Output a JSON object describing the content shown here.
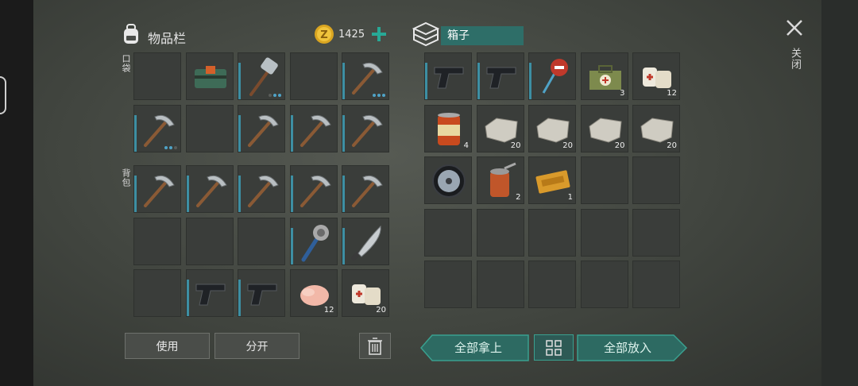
{
  "inventory": {
    "title": "物品栏",
    "coins": "1425",
    "pocket_label": "口袋",
    "backpack_label": "背包"
  },
  "box": {
    "title": "箱子"
  },
  "close_label": "关闭",
  "buttons": {
    "use": "使用",
    "split": "分开",
    "take_all": "全部拿上",
    "put_all": "全部放入"
  },
  "pocket_slots": [
    {
      "item": "empty"
    },
    {
      "item": "explosive-pack"
    },
    {
      "item": "sledgehammer",
      "dots": [
        false,
        true,
        true
      ]
    },
    {
      "item": "empty"
    },
    {
      "item": "pickaxe",
      "dots": [
        true,
        true,
        true
      ]
    },
    {
      "item": "pickaxe",
      "dots": [
        true,
        true,
        false
      ]
    },
    {
      "item": "empty"
    },
    {
      "item": "pickaxe"
    },
    {
      "item": "pickaxe"
    },
    {
      "item": "pickaxe"
    }
  ],
  "backpack_slots": [
    {
      "item": "pickaxe"
    },
    {
      "item": "pickaxe"
    },
    {
      "item": "pickaxe"
    },
    {
      "item": "pickaxe"
    },
    {
      "item": "pickaxe"
    },
    {
      "item": "empty"
    },
    {
      "item": "empty"
    },
    {
      "item": "empty"
    },
    {
      "item": "spiked-club"
    },
    {
      "item": "machete"
    },
    {
      "item": "empty"
    },
    {
      "item": "pistol"
    },
    {
      "item": "pistol"
    },
    {
      "item": "raw-chicken",
      "qty": "12"
    },
    {
      "item": "bandage",
      "qty": "20"
    }
  ],
  "box_slots": [
    {
      "item": "pistol"
    },
    {
      "item": "pistol"
    },
    {
      "item": "stop-sign"
    },
    {
      "item": "medkit-bag",
      "qty": "3"
    },
    {
      "item": "bandage",
      "qty": "12"
    },
    {
      "item": "canned-food",
      "qty": "4"
    },
    {
      "item": "stone",
      "qty": "20"
    },
    {
      "item": "stone",
      "qty": "20"
    },
    {
      "item": "stone",
      "qty": "20"
    },
    {
      "item": "stone",
      "qty": "20"
    },
    {
      "item": "wheel"
    },
    {
      "item": "open-can",
      "qty": "2"
    },
    {
      "item": "coupon",
      "qty": "1"
    }
  ]
}
